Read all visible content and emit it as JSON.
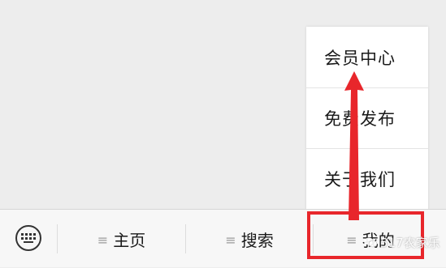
{
  "popup_menu": {
    "items": [
      {
        "label": "会员中心"
      },
      {
        "label": "免费发布"
      },
      {
        "label": "关于我们"
      }
    ]
  },
  "menu_bar": {
    "tabs": [
      {
        "label": "主页",
        "icon": "menu-lines-icon"
      },
      {
        "label": "搜索",
        "icon": "menu-lines-icon"
      },
      {
        "label": "我的",
        "icon": "menu-lines-icon"
      }
    ],
    "keyboard_icon": "keyboard-icon"
  },
  "annotations": {
    "highlight_color": "#e8262b",
    "arrow_color": "#e8262b"
  },
  "watermark": {
    "text": "517农家乐"
  }
}
